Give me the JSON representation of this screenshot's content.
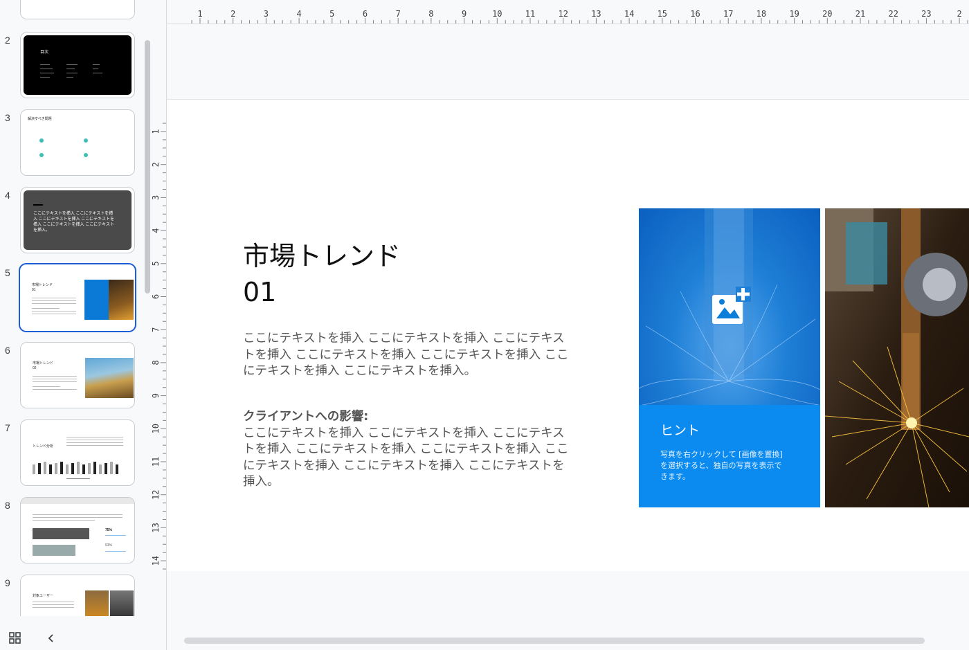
{
  "filmstrip": {
    "slides": [
      {
        "num": "2",
        "title": "目次"
      },
      {
        "num": "3",
        "title": "解決すべき問題"
      },
      {
        "num": "4",
        "text": "ここにテキストを挿入 ここにテキストを挿入 ここにテキストを挿入 ここにテキストを挿入 ここにテキストを挿入 ここにテキストを挿入。"
      },
      {
        "num": "5",
        "title": "市場トレンド\n01"
      },
      {
        "num": "6",
        "title": "市場トレンド\n02"
      },
      {
        "num": "7",
        "title": "トレンド分析"
      },
      {
        "num": "8",
        "stat1": "75%",
        "stat2": "53%"
      },
      {
        "num": "9",
        "title": "対象ユーザー"
      }
    ]
  },
  "ruler": {
    "top_ticks": [
      "1",
      "2",
      "3",
      "4",
      "5",
      "6",
      "7",
      "8",
      "9",
      "10",
      "11",
      "12",
      "13",
      "14",
      "15",
      "16",
      "17",
      "18",
      "19",
      "20",
      "21",
      "22",
      "23",
      "2"
    ],
    "left_ticks": [
      "1",
      "2",
      "3",
      "4",
      "5",
      "6",
      "7",
      "8",
      "9",
      "10",
      "11",
      "12",
      "13",
      "14"
    ]
  },
  "slide": {
    "title": "市場トレンド\n01",
    "paragraph1": "ここにテキストを挿入 ここにテキストを挿入 ここにテキストを挿入 ここにテキストを挿入 ここにテキストを挿入 ここにテキストを挿入 ここにテキストを挿入。",
    "impact_heading": "クライアントへの影響:",
    "paragraph2": "ここにテキストを挿入 ここにテキストを挿入 ここにテキストを挿入 ここにテキストを挿入 ここにテキストを挿入 ここにテキストを挿入 ここにテキストを挿入 ここにテキストを挿入。",
    "hint_title": "ヒント",
    "hint_body": "写真を右クリックして [画像を置換] を選択すると、独自の写真を表示できます。"
  },
  "colors": {
    "selection": "#1a5dd8",
    "hint_blue": "#0b8bf0",
    "accent_dot": "#3bbfb8"
  },
  "icons": [
    "grid-view-icon",
    "collapse-chevron-icon",
    "add-image-icon"
  ]
}
